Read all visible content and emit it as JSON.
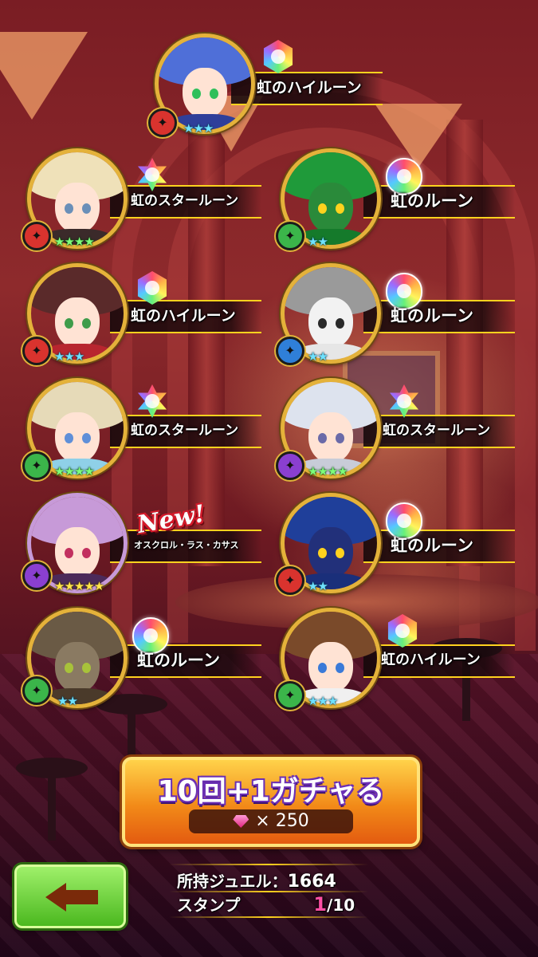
{
  "results": [
    {
      "name": "虹のハイルーン",
      "rune": "hex-rune-icon",
      "attribute": "red-attribute-icon",
      "stars": "★★★",
      "portrait_colors": {
        "hair": "#4f6fd8",
        "eye": "#2fbf5a",
        "body": "#2f3f9a"
      }
    },
    {
      "name": "虹のスタールーン",
      "rune": "star-rune-icon",
      "attribute": "red-attribute-icon",
      "stars": "★★★★",
      "portrait_colors": {
        "hair": "#efe1b9",
        "eye": "#6a8fb8",
        "body": "#3b2a2a"
      }
    },
    {
      "name": "虹のルーン",
      "rune": "slime-rune-icon",
      "attribute": "green-attribute-icon",
      "stars": "★★",
      "portrait_colors": {
        "hair": "#1f9a3a",
        "eye": "#ffd21e",
        "body": "#157a2b"
      }
    },
    {
      "name": "虹のハイルーン",
      "rune": "hex-rune-icon",
      "attribute": "red-attribute-icon",
      "stars": "★★★",
      "portrait_colors": {
        "hair": "#5a2a2a",
        "eye": "#3f9c4a",
        "body": "#b8262f"
      }
    },
    {
      "name": "虹のルーン",
      "rune": "slime-rune-icon",
      "attribute": "blue-attribute-icon",
      "stars": "★★",
      "portrait_colors": {
        "hair": "#9a9a9a",
        "eye": "#2a2a2a",
        "body": "#e6e6e6"
      }
    },
    {
      "name": "虹のスタールーン",
      "rune": "star-rune-icon",
      "attribute": "green-attribute-icon",
      "stars": "★★★★",
      "portrait_colors": {
        "hair": "#e6dab8",
        "eye": "#5f8fd8",
        "body": "#8fd0e8"
      }
    },
    {
      "name": "虹のスタールーン",
      "rune": "star-rune-icon",
      "attribute": "purple-attribute-icon",
      "stars": "★★★★",
      "portrait_colors": {
        "hair": "#dde3ee",
        "eye": "#6a6aa8",
        "body": "#c8ccd8"
      }
    },
    {
      "name": "オスクロル・ラス・カサス",
      "new_label": "New!",
      "attribute": "purple-attribute-icon",
      "stars": "★★★★★",
      "portrait_colors": {
        "hair": "#c79ad8",
        "eye": "#c2305f",
        "body": "#4b2a5a"
      }
    },
    {
      "name": "虹のルーン",
      "rune": "slime-rune-icon",
      "attribute": "red-attribute-icon",
      "stars": "★★",
      "portrait_colors": {
        "hair": "#1f3f9a",
        "eye": "#ffd21e",
        "body": "#1a2f7a"
      }
    },
    {
      "name": "虹のルーン",
      "rune": "slime-rune-icon",
      "attribute": "green-attribute-icon",
      "stars": "★★",
      "portrait_colors": {
        "hair": "#6a5a45",
        "eye": "#a8c23a",
        "body": "#4a3a2a"
      }
    },
    {
      "name": "虹のハイルーン",
      "rune": "hex-rune-icon",
      "attribute": "green-attribute-icon",
      "stars": "★★★",
      "portrait_colors": {
        "hair": "#7a4a2a",
        "eye": "#3a7ad8",
        "body": "#f0f0f0"
      }
    }
  ],
  "gacha_button": {
    "title": "10回+1ガチャる",
    "cost": "× 250"
  },
  "back_button": {
    "icon": "back-arrow-icon"
  },
  "info": {
    "jewel_label": "所持ジュエル：",
    "jewel_value": "1664",
    "stamp_label": "スタンプ",
    "stamp_current": "1",
    "stamp_total": "/10"
  },
  "colors": {
    "accent_gold": "#ffd21e",
    "gacha_orange": "#f28a18",
    "back_green": "#4bb81f",
    "stamp_pink": "#ff4fa5"
  }
}
